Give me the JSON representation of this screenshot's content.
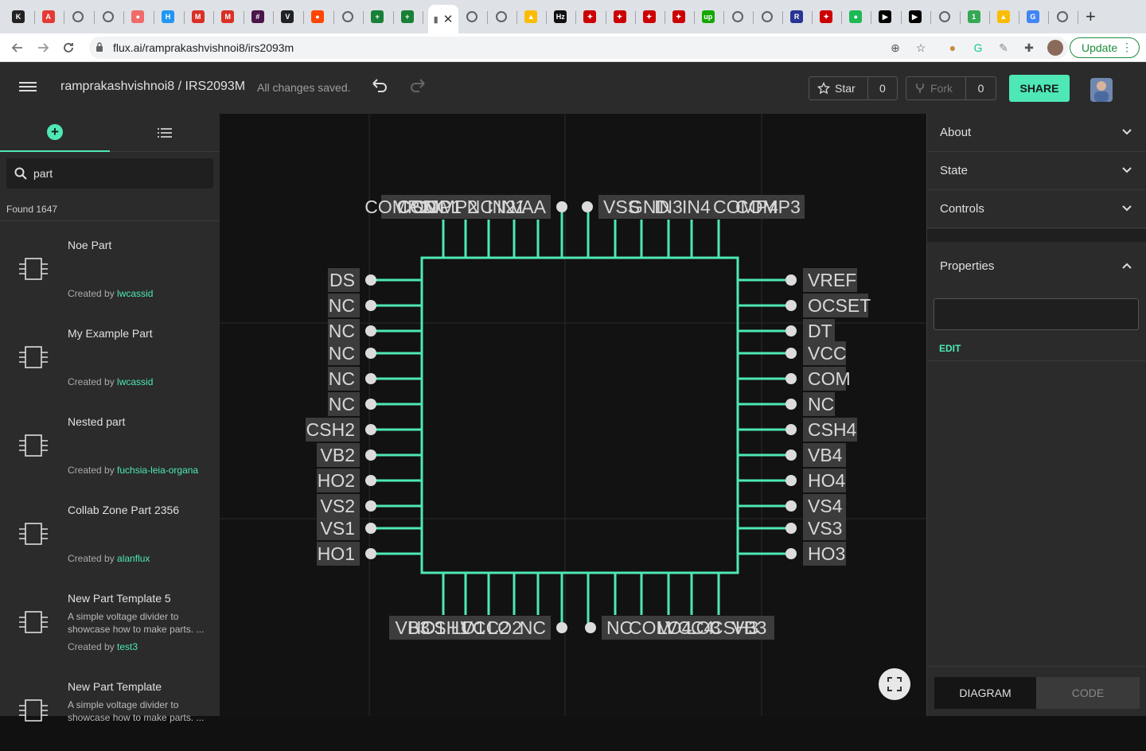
{
  "browser": {
    "url": "flux.ai/ramprakashvishnoi8/irs2093m",
    "update_label": "Update",
    "tab_favicons": [
      {
        "name": "k-tab",
        "glyph": "K",
        "color": "#222222"
      },
      {
        "name": "red-logo-tab",
        "glyph": "A",
        "color": "#e53935"
      },
      {
        "name": "globe-tab",
        "glyph": "",
        "color": "#5f6368"
      },
      {
        "name": "globe-tab",
        "glyph": "",
        "color": "#5f6368"
      },
      {
        "name": "asana-tab",
        "glyph": "●",
        "color": "#f06a6a"
      },
      {
        "name": "h-tab",
        "glyph": "H",
        "color": "#2196f3"
      },
      {
        "name": "gmail-tab",
        "glyph": "M",
        "color": "#d93025"
      },
      {
        "name": "gmail-tab",
        "glyph": "M",
        "color": "#d93025"
      },
      {
        "name": "slack-tab",
        "glyph": "#",
        "color": "#4a154b"
      },
      {
        "name": "v-tab",
        "glyph": "V",
        "color": "#202124"
      },
      {
        "name": "reddit-tab",
        "glyph": "●",
        "color": "#ff4500"
      },
      {
        "name": "globe-tab",
        "glyph": "",
        "color": "#5f6368"
      },
      {
        "name": "sheets-tab",
        "glyph": "+",
        "color": "#188038"
      },
      {
        "name": "sheets-tab",
        "glyph": "+",
        "color": "#188038"
      }
    ],
    "tab_favicons_right": [
      {
        "name": "globe-tab",
        "glyph": "",
        "color": "#5f6368"
      },
      {
        "name": "globe-tab",
        "glyph": "",
        "color": "#5f6368"
      },
      {
        "name": "drive-tab",
        "glyph": "▲",
        "color": "#fbbc04"
      },
      {
        "name": "hz-tab",
        "glyph": "Hz",
        "color": "#111111"
      },
      {
        "name": "ti-tab",
        "glyph": "✦",
        "color": "#cc0000"
      },
      {
        "name": "ti-tab",
        "glyph": "✦",
        "color": "#cc0000"
      },
      {
        "name": "ti-tab",
        "glyph": "✦",
        "color": "#cc0000"
      },
      {
        "name": "ti-tab",
        "glyph": "✦",
        "color": "#cc0000"
      },
      {
        "name": "upwork-tab",
        "glyph": "up",
        "color": "#14a800"
      },
      {
        "name": "globe-tab",
        "glyph": "",
        "color": "#5f6368"
      },
      {
        "name": "globe-tab",
        "glyph": "",
        "color": "#5f6368"
      },
      {
        "name": "r-tab",
        "glyph": "R",
        "color": "#283593"
      },
      {
        "name": "ti-tab",
        "glyph": "✦",
        "color": "#cc0000"
      },
      {
        "name": "spotify-tab",
        "glyph": "●",
        "color": "#1db954"
      },
      {
        "name": "play-tab",
        "glyph": "▶",
        "color": "#000000"
      },
      {
        "name": "play-tab",
        "glyph": "▶",
        "color": "#000000"
      },
      {
        "name": "globe-tab",
        "glyph": "",
        "color": "#5f6368"
      },
      {
        "name": "one-tab",
        "glyph": "1",
        "color": "#34a853"
      },
      {
        "name": "drive-tab",
        "glyph": "▲",
        "color": "#fbbc04"
      },
      {
        "name": "google-tab",
        "glyph": "G",
        "color": "#4285f4"
      },
      {
        "name": "globe-tab",
        "glyph": "",
        "color": "#5f6368"
      }
    ]
  },
  "header": {
    "project_path": "ramprakashvishnoi8 /  IRS2093M",
    "save_status": "All changes saved.",
    "star_label": "Star",
    "star_count": "0",
    "fork_label": "Fork",
    "fork_count": "0",
    "share_label": "SHARE"
  },
  "sidebar": {
    "search_value": "part",
    "found_text": "Found 1647",
    "parts": [
      {
        "title": "Noe Part",
        "description": "",
        "created_prefix": "Created by ",
        "author": "lwcassid"
      },
      {
        "title": "My Example Part",
        "description": "",
        "created_prefix": "Created by ",
        "author": "lwcassid"
      },
      {
        "title": "Nested part",
        "description": "",
        "created_prefix": "Created by ",
        "author": "fuchsia-leia-organa"
      },
      {
        "title": "Collab Zone Part 2356",
        "description": "",
        "created_prefix": "Created by ",
        "author": "alanflux"
      },
      {
        "title": "New Part Template 5",
        "description": "A simple voltage divider to showcase how to make parts. ...",
        "created_prefix": "Created by ",
        "author": "test3"
      },
      {
        "title": "New Part Template",
        "description": "A simple voltage divider to showcase how to make parts. ...",
        "created_prefix": "",
        "author": ""
      }
    ]
  },
  "schematic": {
    "left_pins": [
      "DS",
      "NC",
      "NC",
      "NC",
      "NC",
      "NC",
      "CSH2",
      "VB2",
      "HO2",
      "VS2",
      "VS1",
      "HO1"
    ],
    "right_pins": [
      "VREF",
      "OCSET",
      "DT",
      "VCC",
      "COM",
      "NC",
      "CSH4",
      "VB4",
      "HO4",
      "VS4",
      "VS3",
      "HO3"
    ],
    "top_left_labels": [
      "COMP1",
      "CSD",
      "NC",
      "COMP2",
      "NC",
      "COMP1",
      "IN2",
      "IN1",
      "VAA"
    ],
    "top_right_labels": [
      "VSS",
      "GND",
      "IN3",
      "IN4",
      "COMP4",
      "COMP3"
    ],
    "bottom_left_labels": [
      "VB3",
      "HO1",
      "CSH1",
      "LO1",
      "VCC2",
      "LO2",
      "NC"
    ],
    "bottom_right_labels": [
      "NC",
      "COM",
      "LO4",
      "VCC4",
      "LO3",
      "CSH3",
      "VB3"
    ],
    "accent_color": "#4de8b5"
  },
  "right_panel": {
    "sections": [
      "About",
      "State",
      "Controls"
    ],
    "properties_label": "Properties",
    "edit_label": "EDIT",
    "diagram_tab": "DIAGRAM",
    "code_tab": "CODE"
  }
}
